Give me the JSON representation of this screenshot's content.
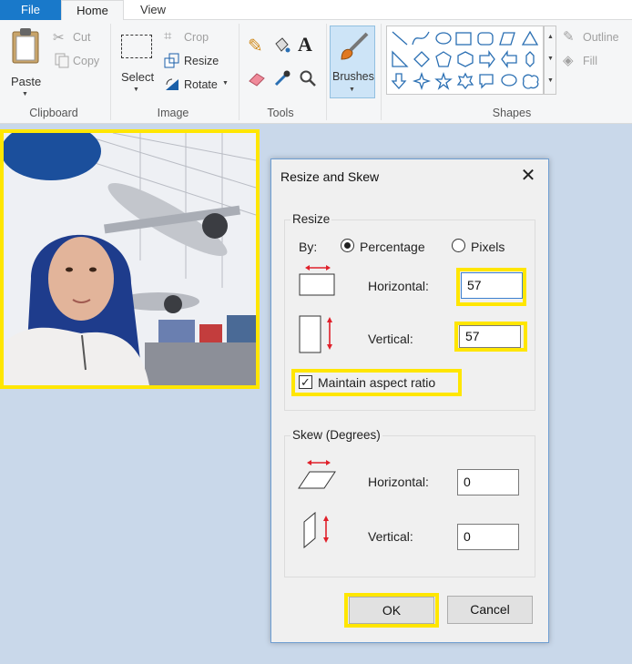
{
  "tabs": {
    "file": "File",
    "home": "Home",
    "view": "View"
  },
  "clipboard": {
    "paste": "Paste",
    "cut": "Cut",
    "copy": "Copy",
    "label": "Clipboard"
  },
  "image": {
    "select": "Select",
    "crop": "Crop",
    "resize": "Resize",
    "rotate": "Rotate",
    "label": "Image"
  },
  "tools": {
    "label": "Tools"
  },
  "brushes": {
    "label": "Brushes"
  },
  "shapes": {
    "outline": "Outline",
    "fill": "Fill",
    "label": "Shapes"
  },
  "dialog": {
    "title": "Resize and Skew",
    "resize_group": "Resize",
    "by_label": "By:",
    "percentage": "Percentage",
    "pixels": "Pixels",
    "horizontal_label": "Horizontal:",
    "horizontal_value": "57",
    "vertical_label": "Vertical:",
    "vertical_value": "57",
    "maintain_aspect": "Maintain aspect ratio",
    "skew_group": "Skew (Degrees)",
    "skew_horizontal_label": "Horizontal:",
    "skew_horizontal_value": "0",
    "skew_vertical_label": "Vertical:",
    "skew_vertical_value": "0",
    "ok": "OK",
    "cancel": "Cancel"
  },
  "colors": {
    "highlight": "#ffe600",
    "file_tab": "#1979ca",
    "arrow_red": "#e0202a",
    "shape_blue": "#2a6fb3"
  }
}
